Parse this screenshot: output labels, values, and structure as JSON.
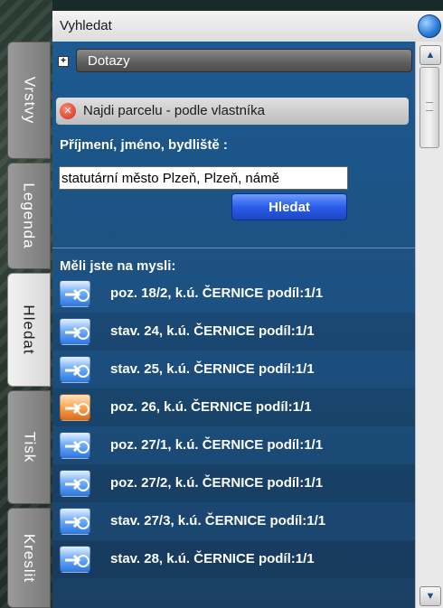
{
  "panel": {
    "title": "Vyhledat"
  },
  "tabs": [
    {
      "label": "Vrstvy"
    },
    {
      "label": "Legenda"
    },
    {
      "label": "Hledat"
    },
    {
      "label": "Tisk"
    },
    {
      "label": "Kreslit"
    }
  ],
  "dotazy": {
    "label": "Dotazy"
  },
  "query": {
    "label": "Najdi parcelu - podle vlastníka"
  },
  "field": {
    "label": "Příjmení, jméno, bydliště :",
    "value": "statutární město Plzeň, Plzeň, námě"
  },
  "search_button": {
    "label": "Hledat"
  },
  "suggestions": {
    "label": "Měli jste na mysli:",
    "items": [
      {
        "label": "poz. 18/2, k.ú. ČERNICE podíl:1/1",
        "icon": "parcel-arrow-icon",
        "highlighted": false
      },
      {
        "label": "stav. 24, k.ú. ČERNICE podíl:1/1",
        "icon": "parcel-arrow-icon",
        "highlighted": false
      },
      {
        "label": "stav. 25, k.ú. ČERNICE podíl:1/1",
        "icon": "parcel-arrow-icon",
        "highlighted": false
      },
      {
        "label": "poz. 26, k.ú. ČERNICE podíl:1/1",
        "icon": "parcel-arrow-icon",
        "highlighted": true
      },
      {
        "label": "poz. 27/1, k.ú. ČERNICE podíl:1/1",
        "icon": "parcel-arrow-icon",
        "highlighted": false
      },
      {
        "label": "poz. 27/2, k.ú. ČERNICE podíl:1/1",
        "icon": "parcel-arrow-icon",
        "highlighted": false
      },
      {
        "label": "stav. 27/3, k.ú. ČERNICE podíl:1/1",
        "icon": "parcel-arrow-icon",
        "highlighted": false
      },
      {
        "label": "stav. 28, k.ú. ČERNICE podíl:1/1",
        "icon": "parcel-arrow-icon",
        "highlighted": false
      }
    ]
  },
  "colors": {
    "accent": "#2a5de8",
    "highlight": "#ff9a3c",
    "panel": "#1d4f7d"
  }
}
